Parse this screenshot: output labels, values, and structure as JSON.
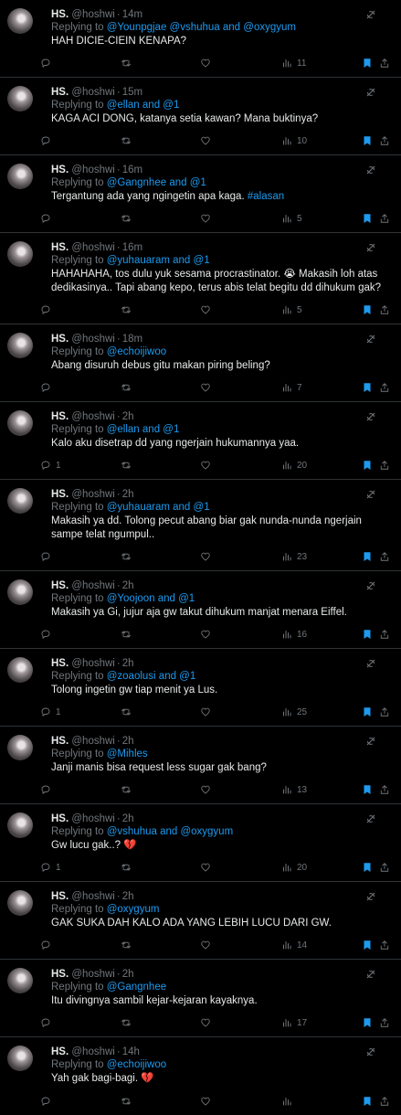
{
  "colors": {
    "background": "#000000",
    "text": "#e7e9ea",
    "muted": "#71767b",
    "accent": "#1d9bf0",
    "divider": "#2f3336"
  },
  "icons": {
    "reply": "reply-icon",
    "retweet": "retweet-icon",
    "like": "heart-icon",
    "views": "views-icon",
    "bookmark": "bookmark-filled-icon",
    "share": "share-icon",
    "grok": "grok-icon"
  },
  "tweets": [
    {
      "name": "HS.",
      "handle": "@hoshwi",
      "sep": "·",
      "time": "14m",
      "reply_prefix": "Replying to ",
      "reply_mentions": "@Younpgjae @vshuhua and @oxygyum",
      "text": "HAH DICIE-CIEIN KENAPA?",
      "replies": "",
      "views": "11"
    },
    {
      "name": "HS.",
      "handle": "@hoshwi",
      "sep": "·",
      "time": "15m",
      "reply_prefix": "Replying to ",
      "reply_mentions": "@ellan and @1",
      "text": "KAGA ACI DONG, katanya setia kawan? Mana buktinya?",
      "replies": "",
      "views": "10"
    },
    {
      "name": "HS.",
      "handle": "@hoshwi",
      "sep": "·",
      "time": "16m",
      "reply_prefix": "Replying to ",
      "reply_mentions": "@Gangnhee and @1",
      "text": "Tergantung ada yang ngingetin apa kaga. ",
      "hashtag": "#alasan",
      "replies": "",
      "views": "5"
    },
    {
      "name": "HS.",
      "handle": "@hoshwi",
      "sep": "·",
      "time": "16m",
      "reply_prefix": "Replying to ",
      "reply_mentions": "@yuhauaram and @1",
      "text": "HAHAHAHA, tos dulu yuk sesama procrastinator. 😭 Makasih loh atas dedikasinya.. Tapi abang kepo, terus abis telat begitu dd dihukum gak?",
      "replies": "",
      "views": "5"
    },
    {
      "name": "HS.",
      "handle": "@hoshwi",
      "sep": "·",
      "time": "18m",
      "reply_prefix": "Replying to ",
      "reply_mentions": "@echoijiwoo",
      "text": "Abang disuruh debus gitu makan piring beling?",
      "replies": "",
      "views": "7"
    },
    {
      "name": "HS.",
      "handle": "@hoshwi",
      "sep": "·",
      "time": "2h",
      "reply_prefix": "Replying to ",
      "reply_mentions": "@ellan and @1",
      "text": "Kalo aku disetrap dd yang ngerjain hukumannya yaa.",
      "replies": "1",
      "views": "20"
    },
    {
      "name": "HS.",
      "handle": "@hoshwi",
      "sep": "·",
      "time": "2h",
      "reply_prefix": "Replying to ",
      "reply_mentions": "@yuhauaram and @1",
      "text": "Makasih ya dd. Tolong pecut abang biar gak nunda-nunda ngerjain sampe telat ngumpul..",
      "replies": "",
      "views": "23"
    },
    {
      "name": "HS.",
      "handle": "@hoshwi",
      "sep": "·",
      "time": "2h",
      "reply_prefix": "Replying to ",
      "reply_mentions": "@Yoojoon and @1",
      "text": "Makasih ya Gi, jujur aja gw takut dihukum manjat menara Eiffel.",
      "replies": "",
      "views": "16"
    },
    {
      "name": "HS.",
      "handle": "@hoshwi",
      "sep": "·",
      "time": "2h",
      "reply_prefix": "Replying to ",
      "reply_mentions": "@zoaolusi and @1",
      "text": "Tolong ingetin gw tiap menit ya Lus.",
      "replies": "1",
      "views": "25"
    },
    {
      "name": "HS.",
      "handle": "@hoshwi",
      "sep": "·",
      "time": "2h",
      "reply_prefix": "Replying to ",
      "reply_mentions": "@Mihles",
      "text": "Janji manis bisa request less sugar gak bang?",
      "replies": "",
      "views": "13"
    },
    {
      "name": "HS.",
      "handle": "@hoshwi",
      "sep": "·",
      "time": "2h",
      "reply_prefix": "Replying to ",
      "reply_mentions": "@vshuhua and @oxygyum",
      "text": "Gw lucu gak..? 💔",
      "replies": "1",
      "views": "20"
    },
    {
      "name": "HS.",
      "handle": "@hoshwi",
      "sep": "·",
      "time": "2h",
      "reply_prefix": "Replying to ",
      "reply_mentions": "@oxygyum",
      "text": "GAK SUKA DAH KALO ADA YANG LEBIH LUCU DARI GW.",
      "replies": "",
      "views": "14"
    },
    {
      "name": "HS.",
      "handle": "@hoshwi",
      "sep": "·",
      "time": "2h",
      "reply_prefix": "Replying to ",
      "reply_mentions": "@Gangnhee",
      "text": "Itu divingnya sambil kejar-kejaran kayaknya.",
      "replies": "",
      "views": "17"
    },
    {
      "name": "HS.",
      "handle": "@hoshwi",
      "sep": "·",
      "time": "14h",
      "reply_prefix": "Replying to ",
      "reply_mentions": "@echoijiwoo",
      "text": "Yah gak bagi-bagi. 💔",
      "replies": "",
      "views": ""
    }
  ]
}
